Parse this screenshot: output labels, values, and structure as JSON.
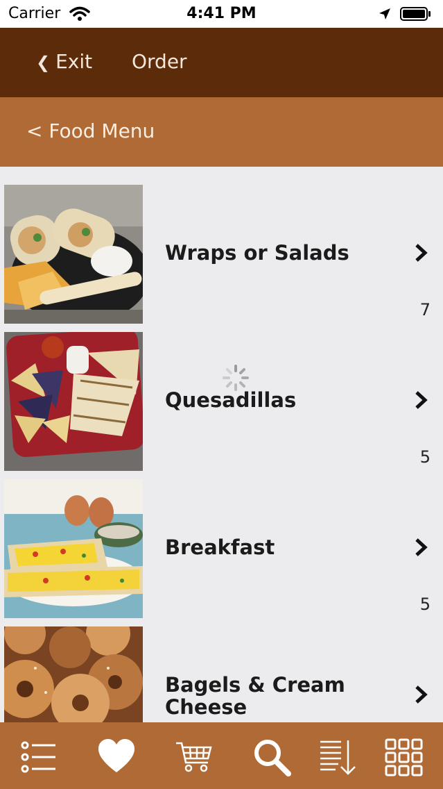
{
  "status_bar": {
    "carrier": "Carrier",
    "time": "4:41 PM"
  },
  "top_nav": {
    "exit_chevron": "❮",
    "exit_label": "Exit",
    "order_label": "Order"
  },
  "sub_header": {
    "back_label": "< Food Menu"
  },
  "menu_items": [
    {
      "title": "Wraps or Salads",
      "count": "7",
      "image": "wraps-photo"
    },
    {
      "title": "Quesadillas",
      "count": "5",
      "image": "quesadillas-photo"
    },
    {
      "title": "Breakfast",
      "count": "5",
      "image": "breakfast-photo"
    },
    {
      "title": "Bagels & Cream Cheese",
      "count": "",
      "image": "bagels-photo"
    }
  ],
  "tab_bar": {
    "tabs": [
      "list-icon",
      "heart-icon",
      "cart-icon",
      "search-icon",
      "sort-icon",
      "grid-icon"
    ]
  },
  "colors": {
    "top_nav_bg": "#5c2c0a",
    "sub_header_bg": "#b06a35",
    "list_bg": "#ececee",
    "tab_bar_bg": "#b06a35"
  }
}
